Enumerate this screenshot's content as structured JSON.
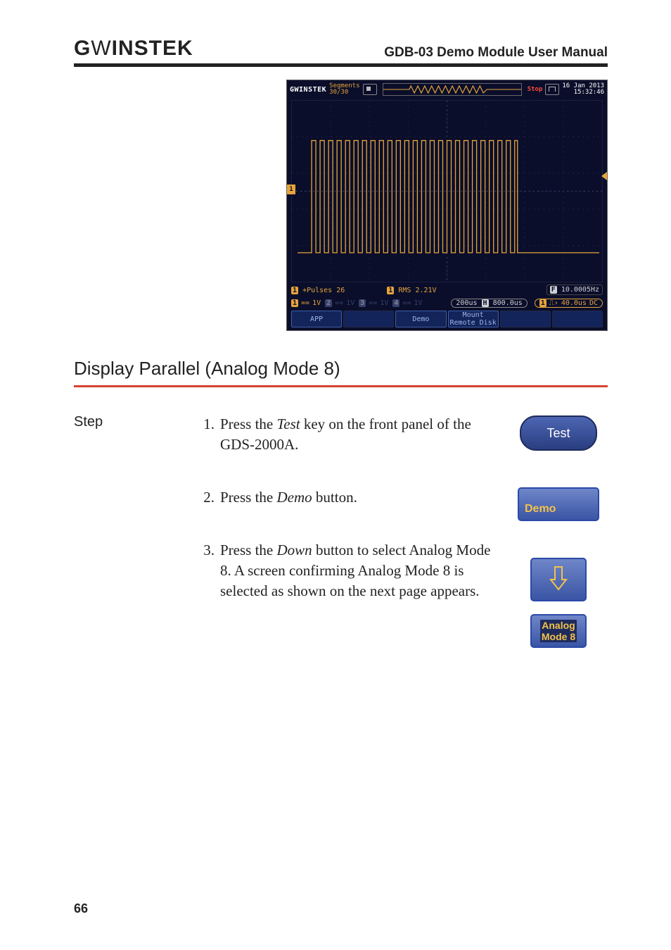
{
  "header": {
    "logo_text": "GWINSTEK",
    "title": "GDB-03 Demo Module User Manual"
  },
  "scope": {
    "brand": "GWINSTEK",
    "segments_label": "Segments",
    "segments_value": "30/30",
    "status": "Stop",
    "date": "16 Jan 2013",
    "time": "15:32:46",
    "measure_pulses_label": "+Pulses",
    "measure_pulses_value": "26",
    "measure_rms_label": "RMS",
    "measure_rms_value": "2.21V",
    "freq_label": "10.0005Hz",
    "ch1_label": "1V",
    "ch2_label": "1V",
    "ch3_label": "1V",
    "ch4_label": "1V",
    "timebase": "200us",
    "delay": "800.0us",
    "trig_label": "40.0us",
    "trig_coupling": "DC",
    "softkeys": [
      "APP",
      "",
      "Demo",
      "Mount\nRemote Disk",
      "",
      ""
    ],
    "ch_marker": "1",
    "freq_icon": "F",
    "timebase_icon": "H",
    "trig_ch": "1"
  },
  "section": {
    "heading": "Display Parallel (Analog Mode 8)"
  },
  "steps": {
    "label": "Step",
    "items": [
      {
        "num": "1.",
        "text_a": "Press the ",
        "em": "Test",
        "text_b": " key on the front panel of the GDS-2000A."
      },
      {
        "num": "2.",
        "text_a": "Press the ",
        "em": "Demo",
        "text_b": " button."
      },
      {
        "num": "3.",
        "text_a": "Press the ",
        "em": "Down",
        "text_b": " button to select Analog Mode 8. A screen confirming Analog Mode 8 is selected as shown on the next page appears."
      }
    ]
  },
  "buttons": {
    "test": "Test",
    "demo": "Demo",
    "mode_line1": "Analog",
    "mode_line2": "Mode 8"
  },
  "page_number": "66"
}
